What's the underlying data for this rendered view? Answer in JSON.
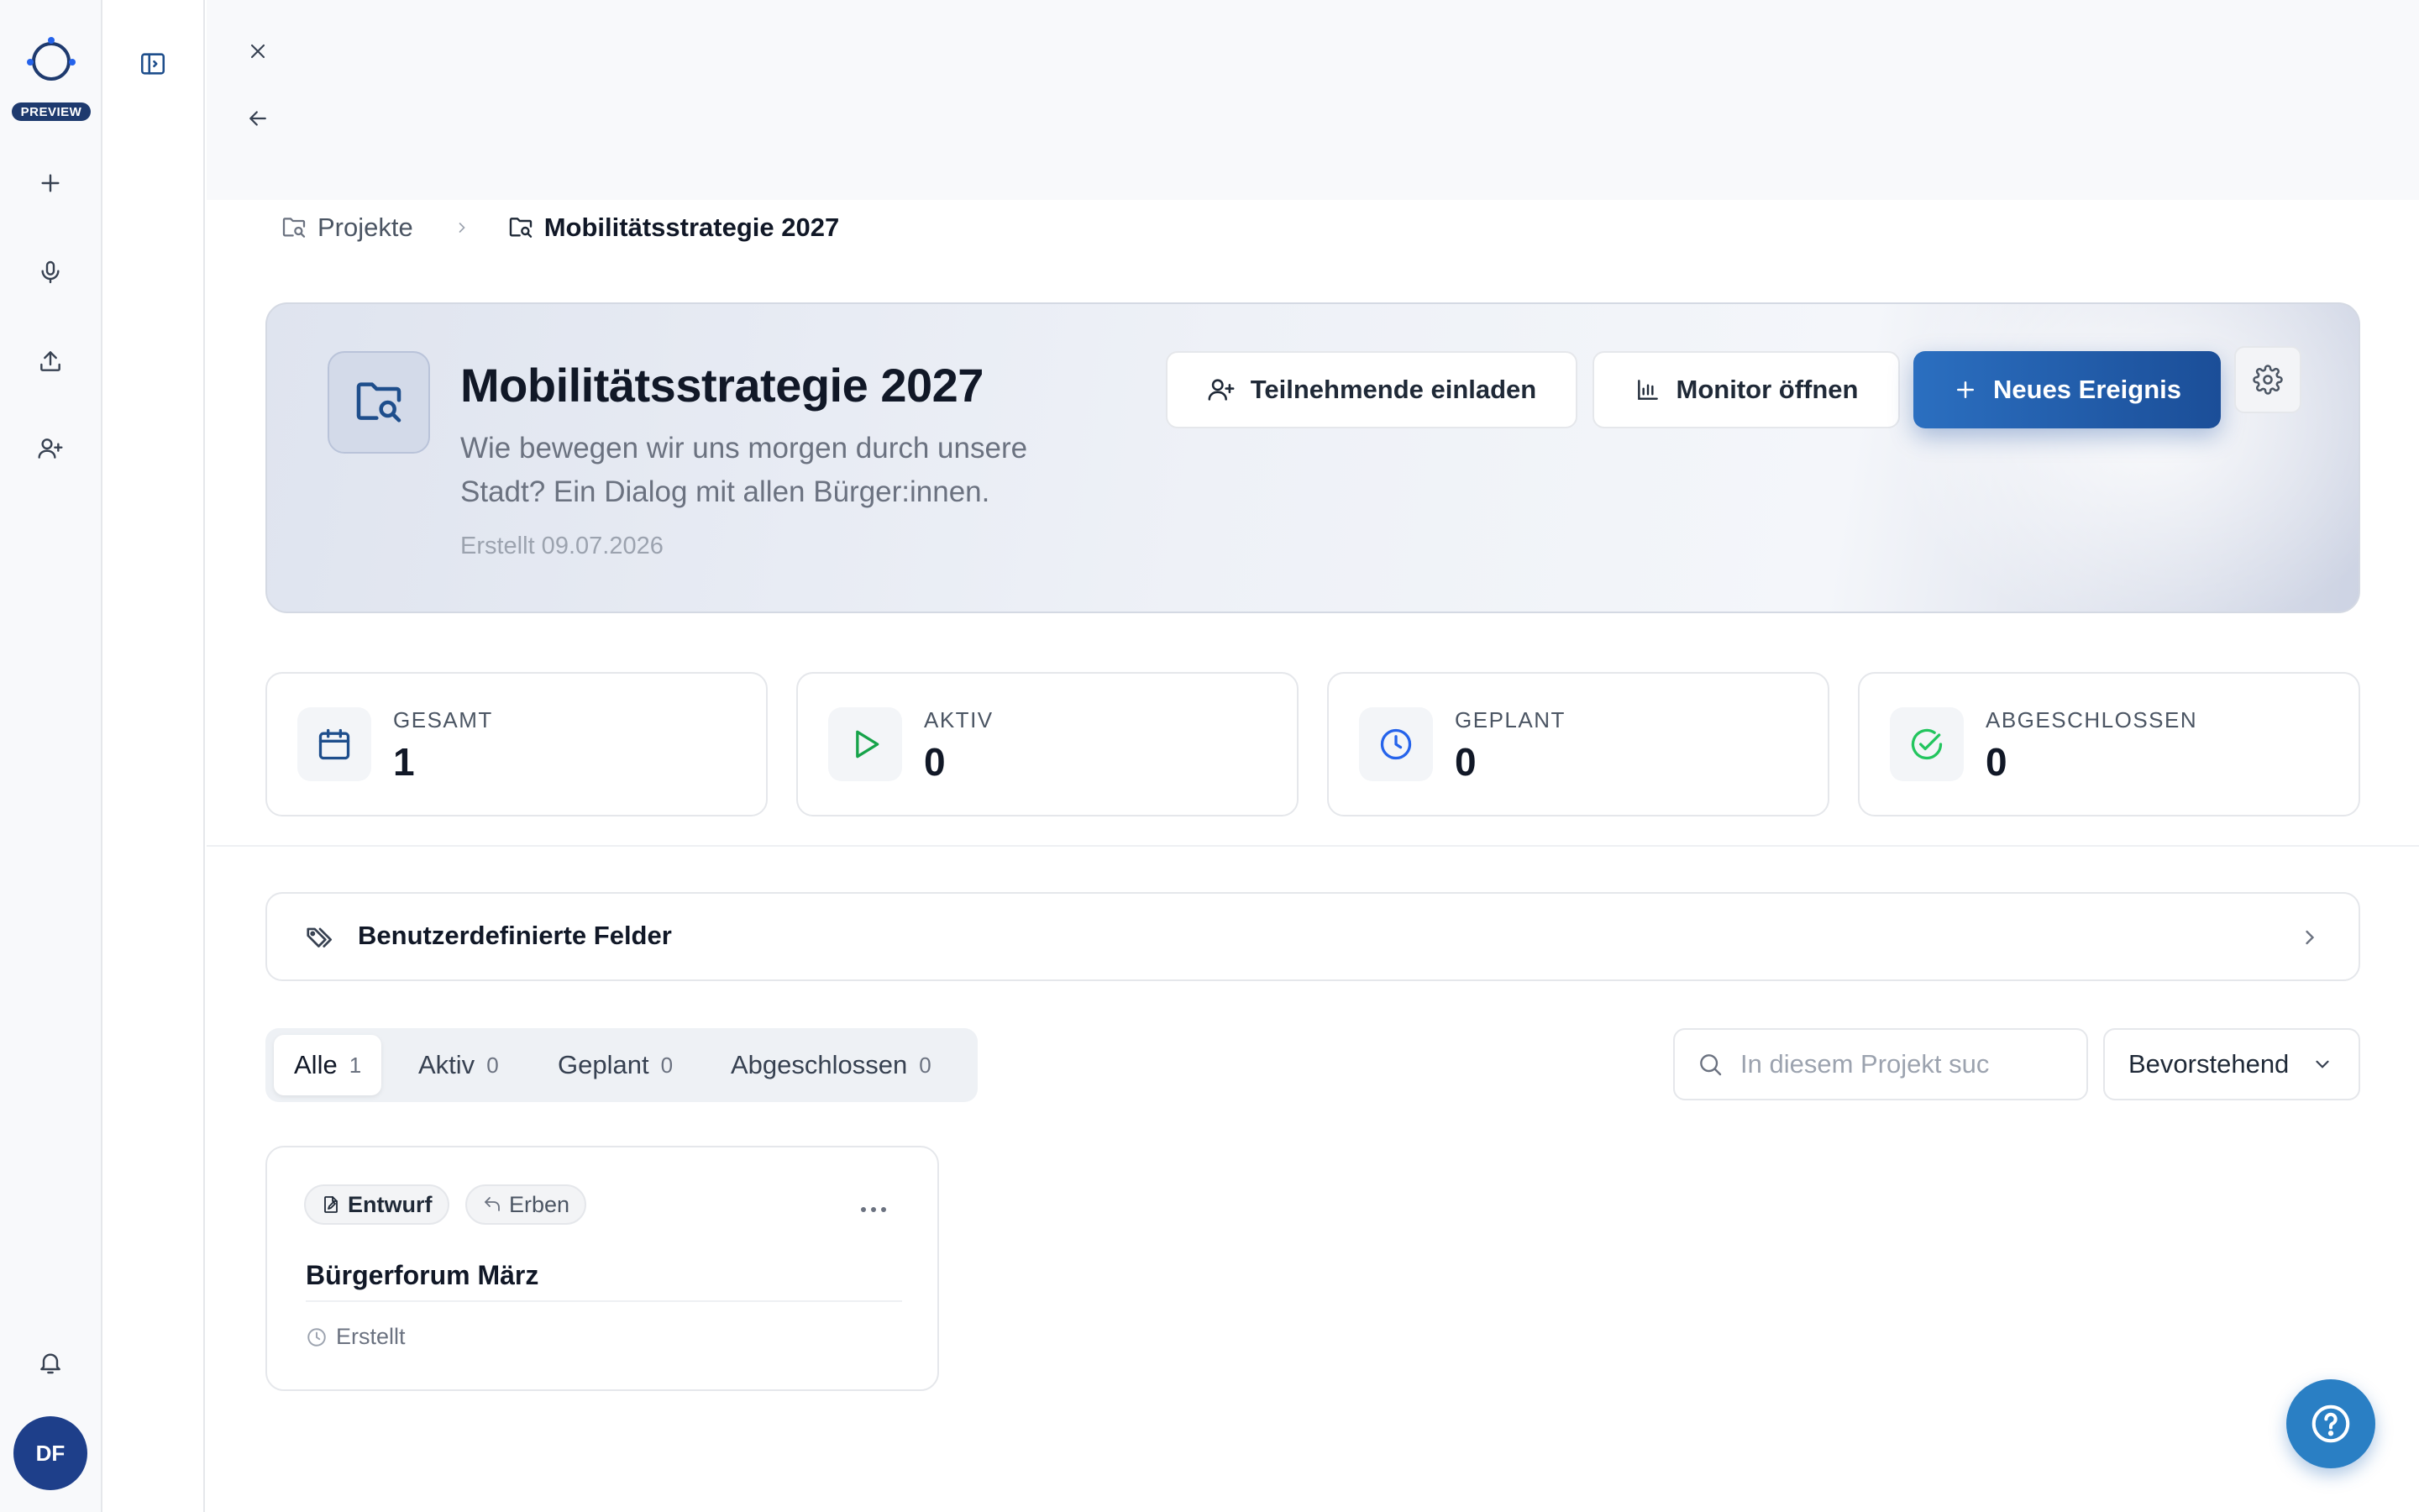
{
  "rail": {
    "badge": "PREVIEW",
    "items": [
      {
        "icon": "plus-icon",
        "label": "Neu"
      },
      {
        "icon": "microphone-icon",
        "label": "Aufnehmen"
      },
      {
        "icon": "upload-icon",
        "label": "Hochladen"
      },
      {
        "icon": "user-plus-icon",
        "label": "Einladen"
      }
    ],
    "avatar_initials": "DF"
  },
  "breadcrumb": {
    "root": "Projekte",
    "current": "Mobilitätsstrategie 2027"
  },
  "project": {
    "title": "Mobilitätsstrategie 2027",
    "description": "Wie bewegen wir uns morgen durch unsere Stadt? Ein Dialog mit allen Bürger:innen.",
    "created": "Erstellt 09.07.2026"
  },
  "actions": {
    "invite": "Teilnehmende einladen",
    "monitor": "Monitor öffnen",
    "new_event": "Neues Ereignis"
  },
  "stats": [
    {
      "label": "GESAMT",
      "value": "1",
      "icon": "calendar-icon",
      "color": "#1e4e8c"
    },
    {
      "label": "AKTIV",
      "value": "0",
      "icon": "play-icon",
      "color": "#16a34a"
    },
    {
      "label": "GEPLANT",
      "value": "0",
      "icon": "clock-icon",
      "color": "#2563eb"
    },
    {
      "label": "ABGESCHLOSSEN",
      "value": "0",
      "icon": "check-circle-icon",
      "color": "#22c55e"
    }
  ],
  "custom_fields": {
    "label": "Benutzerdefinierte Felder"
  },
  "tabs": [
    {
      "label": "Alle",
      "count": "1",
      "active": true
    },
    {
      "label": "Aktiv",
      "count": "0",
      "active": false
    },
    {
      "label": "Geplant",
      "count": "0",
      "active": false
    },
    {
      "label": "Abgeschlossen",
      "count": "0",
      "active": false
    }
  ],
  "search": {
    "placeholder": "In diesem Projekt suc"
  },
  "sort": {
    "selected": "Bevorstehend"
  },
  "events": [
    {
      "status": "Entwurf",
      "inherit": "Erben",
      "title": "Bürgerforum März",
      "meta": "Erstellt"
    }
  ],
  "colors": {
    "brand": "#1e3a6e",
    "primary_button": "#2563ae",
    "help_button": "#2a7fc4"
  }
}
